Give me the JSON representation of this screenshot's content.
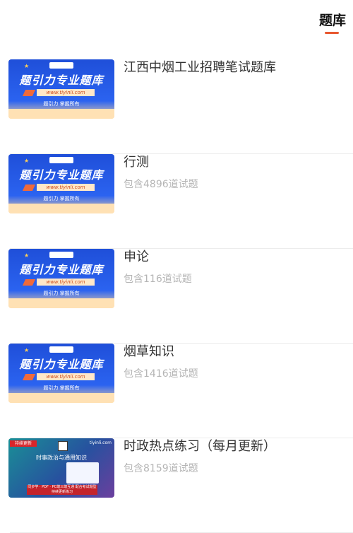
{
  "header": {
    "active_tab": "题库"
  },
  "items": [
    {
      "name": "江西中烟工业招聘笔试题库",
      "count": "",
      "thumb": {
        "kind": "banner",
        "title": "题引力专业题库",
        "url": "www.tiyinli.com",
        "subtitle": "题引力 掌握所有"
      }
    },
    {
      "name": "行测",
      "count": "包含4896道试题",
      "thumb": {
        "kind": "banner",
        "title": "题引力专业题库",
        "url": "www.tiyinli.com",
        "subtitle": "题引力 掌握所有"
      }
    },
    {
      "name": "申论",
      "count": "包含116道试题",
      "thumb": {
        "kind": "banner",
        "title": "题引力专业题库",
        "url": "www.tiyinli.com",
        "subtitle": "题引力 掌握所有"
      }
    },
    {
      "name": "烟草知识",
      "count": "包含1416道试题",
      "thumb": {
        "kind": "banner",
        "title": "题引力专业题库",
        "url": "www.tiyinli.com",
        "subtitle": "题引力 掌握所有"
      }
    },
    {
      "name": "时政热点练习（每月更新）",
      "count": "包含8159道试题",
      "thumb": {
        "kind": "alt",
        "flag": "持续更新",
        "site": "tiyinli.com",
        "headline": "时事政治与通用知识",
        "box_text": "同步学 · PDF · PC端三端互通 配合考试题型持续更新练习"
      }
    }
  ]
}
